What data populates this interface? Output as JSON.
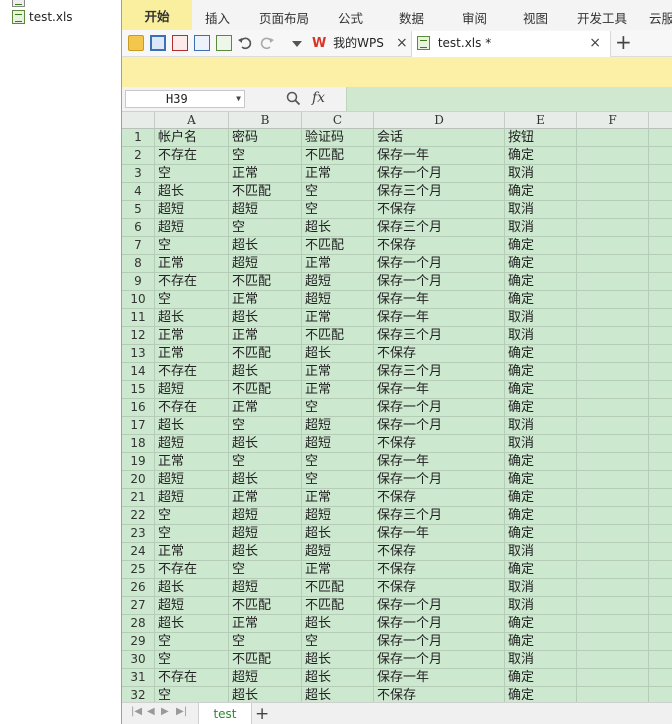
{
  "explorer": {
    "items": [
      {
        "label": "test.xls"
      }
    ]
  },
  "ribbon": {
    "tabs": [
      "开始",
      "插入",
      "页面布局",
      "公式",
      "数据",
      "审阅",
      "视图",
      "开发工具",
      "云服"
    ]
  },
  "doc_tabs": {
    "wps_label": "我的WPS",
    "file_label": "test.xls *",
    "close_glyph": "×",
    "add_glyph": "+"
  },
  "formula": {
    "name_box": "H39",
    "fx_label": "fx",
    "value": ""
  },
  "columns": [
    "A",
    "B",
    "C",
    "D",
    "E",
    "F"
  ],
  "rows": [
    [
      "帐户名",
      "密码",
      "验证码",
      "会话",
      "按钮"
    ],
    [
      "不存在",
      "空",
      "不匹配",
      "保存一年",
      "确定"
    ],
    [
      "空",
      "正常",
      "正常",
      "保存一个月",
      "取消"
    ],
    [
      "超长",
      "不匹配",
      "空",
      "保存三个月",
      "确定"
    ],
    [
      "超短",
      "超短",
      "空",
      "不保存",
      "取消"
    ],
    [
      "超短",
      "空",
      "超长",
      "保存三个月",
      "取消"
    ],
    [
      "空",
      "超长",
      "不匹配",
      "不保存",
      "确定"
    ],
    [
      "正常",
      "超短",
      "正常",
      "保存一个月",
      "确定"
    ],
    [
      "不存在",
      "不匹配",
      "超短",
      "保存一个月",
      "确定"
    ],
    [
      "空",
      "正常",
      "超短",
      "保存一年",
      "确定"
    ],
    [
      "超长",
      "超长",
      "正常",
      "保存一年",
      "取消"
    ],
    [
      "正常",
      "正常",
      "不匹配",
      "保存三个月",
      "取消"
    ],
    [
      "正常",
      "不匹配",
      "超长",
      "不保存",
      "确定"
    ],
    [
      "不存在",
      "超长",
      "正常",
      "保存三个月",
      "确定"
    ],
    [
      "超短",
      "不匹配",
      "正常",
      "保存一年",
      "确定"
    ],
    [
      "不存在",
      "正常",
      "空",
      "保存一个月",
      "确定"
    ],
    [
      "超长",
      "空",
      "超短",
      "保存一个月",
      "取消"
    ],
    [
      "超短",
      "超长",
      "超短",
      "不保存",
      "取消"
    ],
    [
      "正常",
      "空",
      "空",
      "保存一年",
      "确定"
    ],
    [
      "超短",
      "超长",
      "空",
      "保存一个月",
      "确定"
    ],
    [
      "超短",
      "正常",
      "正常",
      "不保存",
      "确定"
    ],
    [
      "空",
      "超短",
      "超短",
      "保存三个月",
      "确定"
    ],
    [
      "空",
      "超短",
      "超长",
      "保存一年",
      "确定"
    ],
    [
      "正常",
      "超长",
      "超短",
      "不保存",
      "取消"
    ],
    [
      "不存在",
      "空",
      "正常",
      "不保存",
      "确定"
    ],
    [
      "超长",
      "超短",
      "不匹配",
      "不保存",
      "取消"
    ],
    [
      "超短",
      "不匹配",
      "不匹配",
      "保存一个月",
      "取消"
    ],
    [
      "超长",
      "正常",
      "超长",
      "保存一个月",
      "确定"
    ],
    [
      "空",
      "空",
      "空",
      "保存一个月",
      "确定"
    ],
    [
      "空",
      "不匹配",
      "超长",
      "保存一个月",
      "取消"
    ],
    [
      "不存在",
      "超短",
      "超长",
      "保存一年",
      "确定"
    ],
    [
      "空",
      "超长",
      "超长",
      "不保存",
      "确定"
    ]
  ],
  "sheets": {
    "tabs": [
      "test"
    ],
    "add_glyph": "+"
  },
  "colors": {
    "grid_bg": "#cce8cf",
    "active_tab": "#f9ef9e",
    "notice_bar": "#fbf0a6"
  }
}
